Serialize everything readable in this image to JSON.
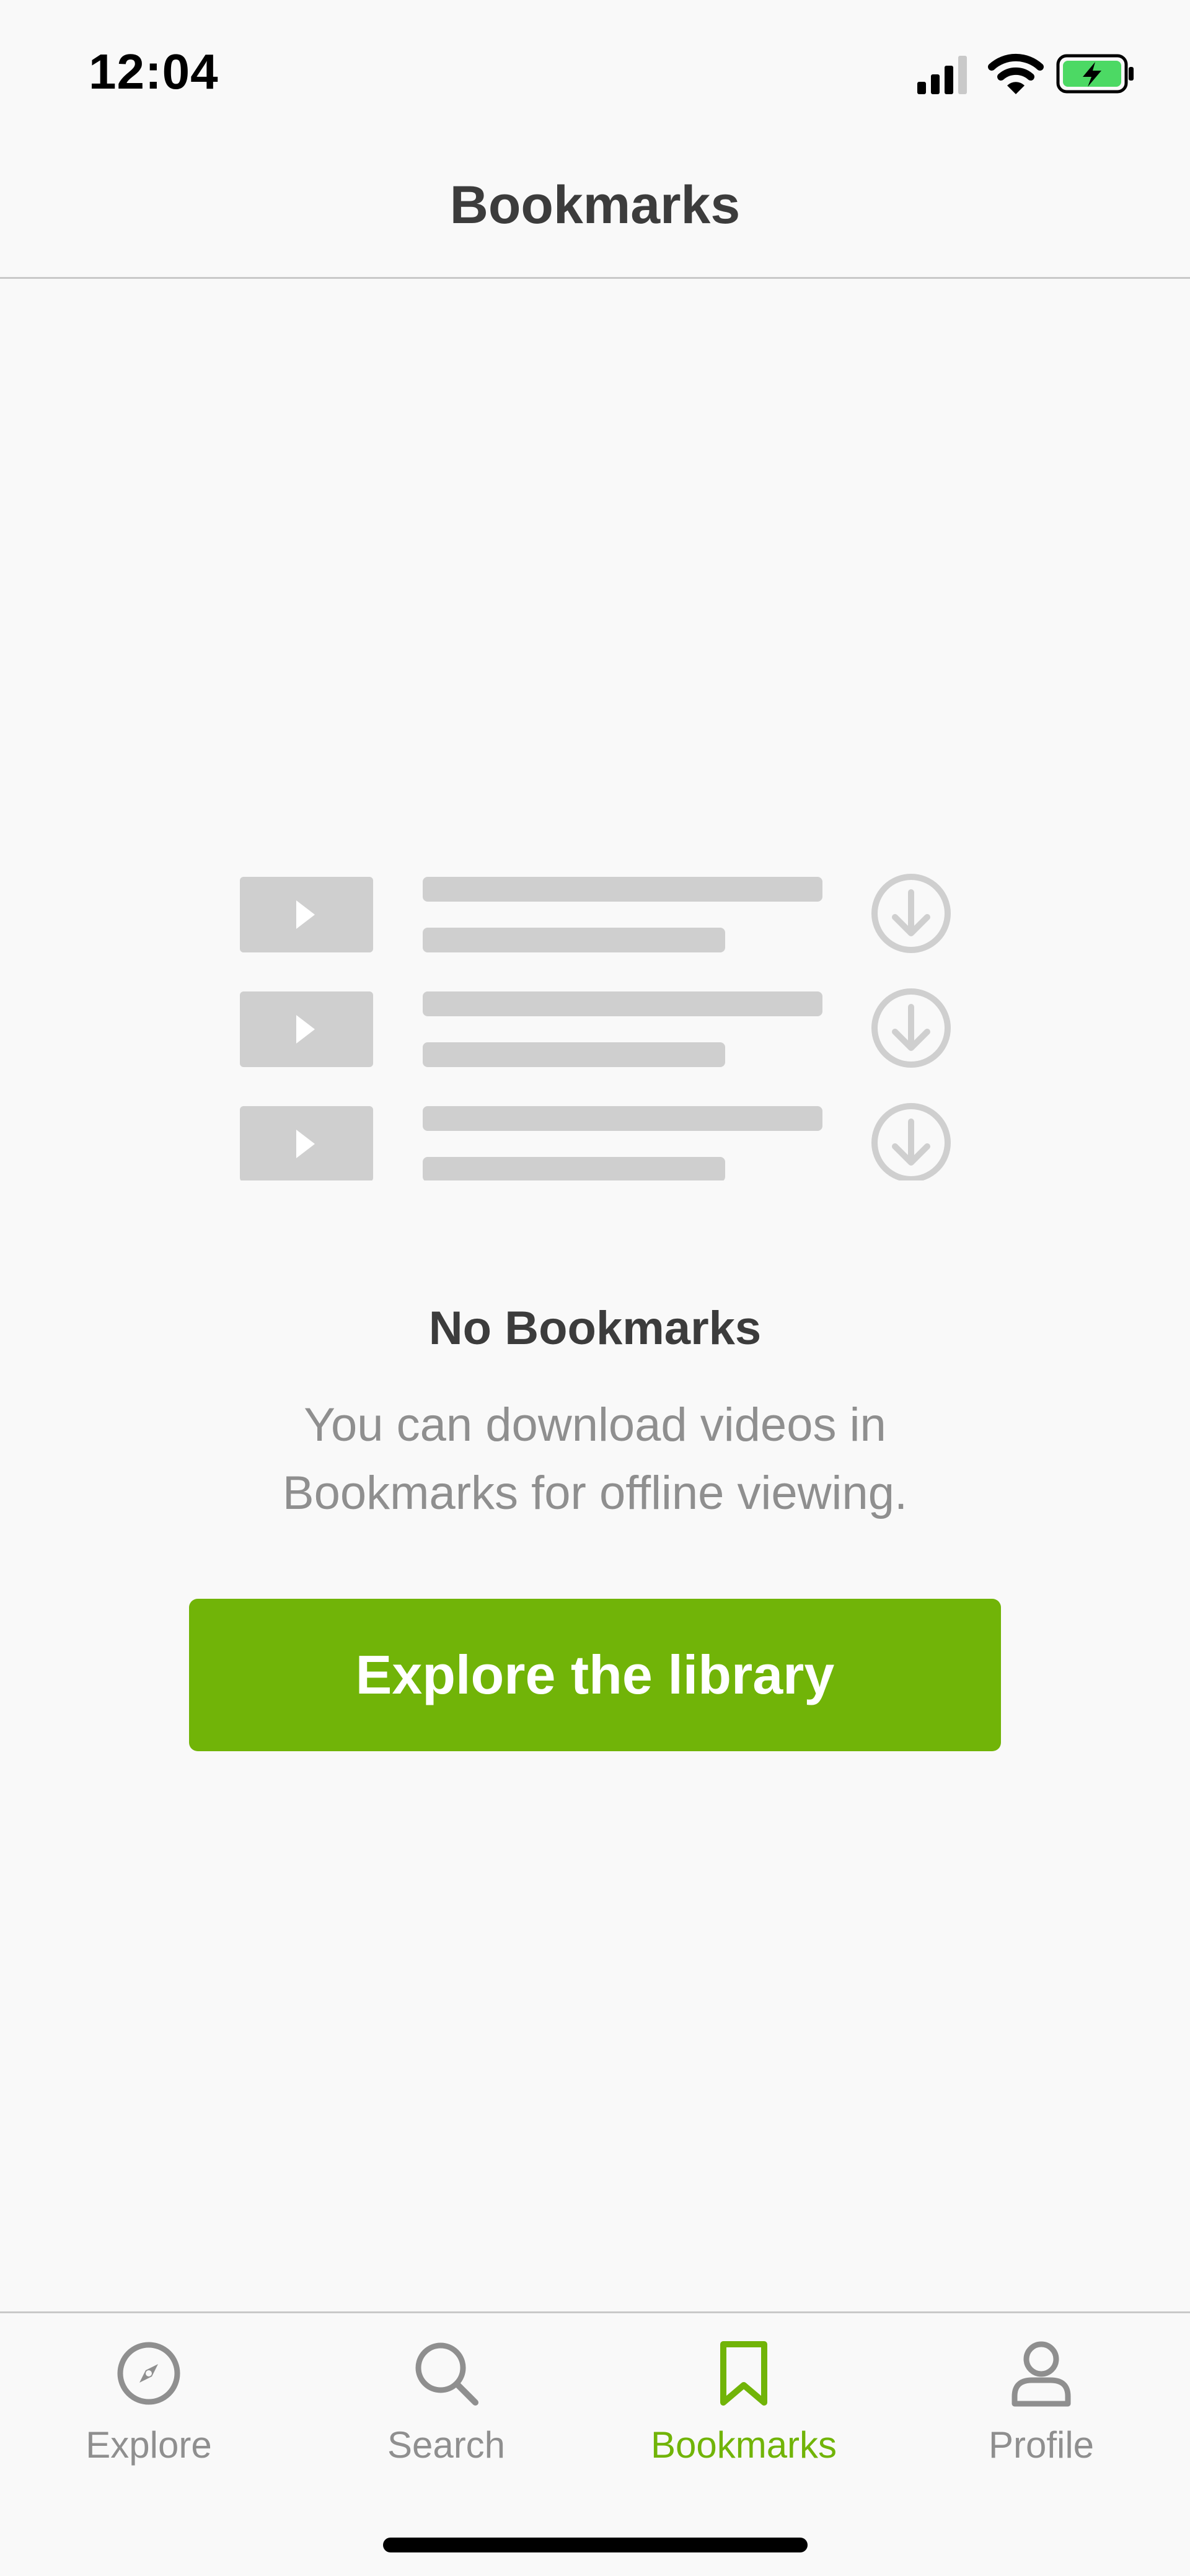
{
  "status_bar": {
    "time": "12:04",
    "icons": [
      "cellular-signal-icon",
      "wifi-icon",
      "battery-charging-icon"
    ]
  },
  "header": {
    "title": "Bookmarks"
  },
  "illustration": {
    "icons": [
      "video-thumbnail-icon",
      "download-icon"
    ]
  },
  "empty_state": {
    "title": "No Bookmarks",
    "description": "You can download videos in Bookmarks for offline viewing.",
    "button_label": "Explore the library"
  },
  "tab_bar": {
    "tabs": [
      {
        "label": "Explore",
        "icon": "compass-icon",
        "active": false
      },
      {
        "label": "Search",
        "icon": "search-icon",
        "active": false
      },
      {
        "label": "Bookmarks",
        "icon": "bookmark-icon",
        "active": true
      },
      {
        "label": "Profile",
        "icon": "person-icon",
        "active": false
      }
    ]
  },
  "colors": {
    "accent": "#71b408",
    "inactive": "#8f8f8f",
    "title_text": "#3c3c3c",
    "background": "#f9f9f9",
    "placeholder_grey": "#cfcfcf"
  }
}
